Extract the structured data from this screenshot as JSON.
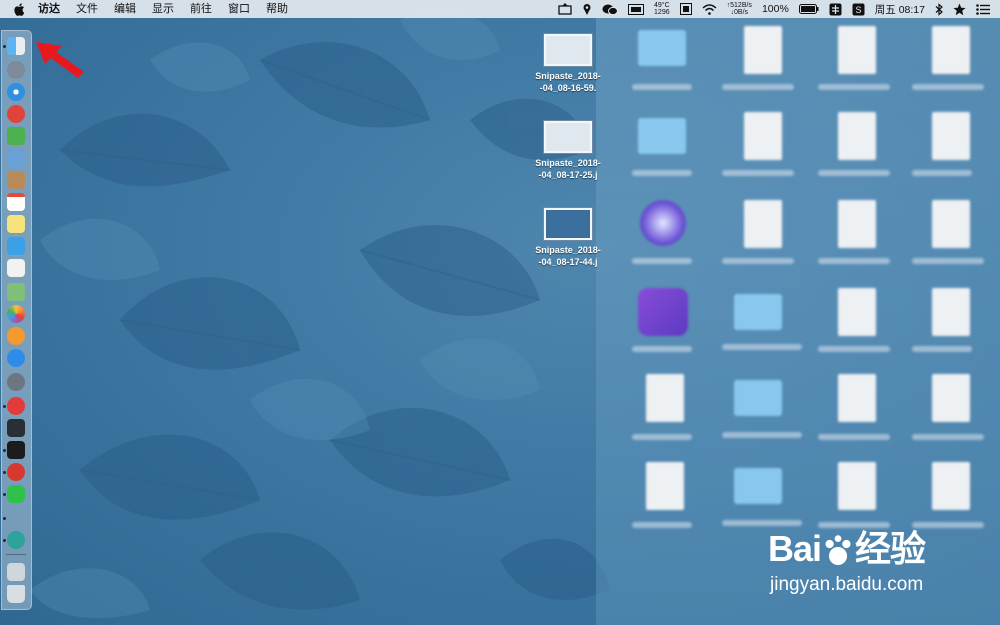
{
  "menubar": {
    "apple_icon": "apple-logo-icon",
    "items": [
      "访达",
      "文件",
      "编辑",
      "显示",
      "前往",
      "窗口",
      "帮助"
    ],
    "status": {
      "temperature": "49°C",
      "fan": "1296",
      "net_up": "↑512B/s",
      "net_down": "↓0B/s",
      "battery": "100%",
      "datetime": "周五 08:17"
    }
  },
  "dock": {
    "apps": [
      {
        "name": "finder",
        "color": "#5fb2ef",
        "running": true
      },
      {
        "name": "launchpad",
        "color": "#7c8a99",
        "running": false
      },
      {
        "name": "safari",
        "color": "#2f8fe0",
        "running": false
      },
      {
        "name": "netease-music",
        "color": "#e0433a",
        "running": false
      },
      {
        "name": "android-file-transfer",
        "color": "#4caf50",
        "running": false
      },
      {
        "name": "preview",
        "color": "#6aa0d8",
        "running": false
      },
      {
        "name": "contacts",
        "color": "#b98b5a",
        "running": false
      },
      {
        "name": "calendar",
        "color": "#ffffff",
        "running": false
      },
      {
        "name": "notes",
        "color": "#f6e27a",
        "running": false
      },
      {
        "name": "image-capture",
        "color": "#3aa0e8",
        "running": false
      },
      {
        "name": "reminders",
        "color": "#f2f2f2",
        "running": false
      },
      {
        "name": "maps",
        "color": "#7ec07a",
        "running": false
      },
      {
        "name": "photos",
        "color": "#f08a3c",
        "running": false
      },
      {
        "name": "books",
        "color": "#f49a2c",
        "running": false
      },
      {
        "name": "app-store",
        "color": "#2d8cea",
        "running": false
      },
      {
        "name": "system-preferences",
        "color": "#6d7680",
        "running": false
      },
      {
        "name": "vivaldi",
        "color": "#e23b3b",
        "running": true
      },
      {
        "name": "activity-monitor",
        "color": "#2a2f36",
        "running": false
      },
      {
        "name": "terminal",
        "color": "#1c1c1c",
        "running": true
      },
      {
        "name": "netease-cloud-music",
        "color": "#d63a2f",
        "running": true
      },
      {
        "name": "wechat",
        "color": "#2ec24b",
        "running": true
      },
      {
        "name": "snipaste",
        "color": "#2fa39a",
        "running": true
      },
      {
        "name": "downloads-stack",
        "color": "#cfd6dc",
        "running": false
      },
      {
        "name": "trash",
        "color": "#d9dee3",
        "running": false
      }
    ]
  },
  "desktop": {
    "files": [
      {
        "name_line1": "Snipaste_2018-",
        "name_line2": "-04_08-16-59."
      },
      {
        "name_line1": "Snipaste_2018-",
        "name_line2": "-04_08-17-25.j"
      },
      {
        "name_line1": "Snipaste_2018-",
        "name_line2": "-04_08-17-44.j"
      }
    ]
  },
  "watermark": {
    "brand_a": "Bai",
    "brand_b": "经验",
    "url": "jingyan.baidu.com"
  }
}
